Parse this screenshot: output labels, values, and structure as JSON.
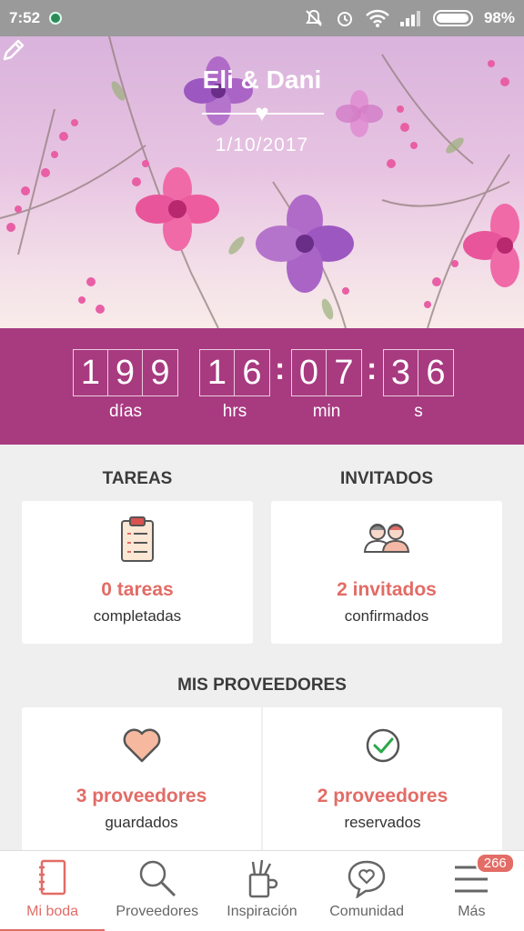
{
  "status_bar": {
    "time": "7:52",
    "battery": "98%"
  },
  "header": {
    "couple": "Eli & Dani",
    "date": "1/10/2017"
  },
  "countdown": {
    "days": [
      "1",
      "9",
      "9"
    ],
    "hours": [
      "1",
      "6"
    ],
    "minutes": [
      "0",
      "7"
    ],
    "seconds": [
      "3",
      "6"
    ],
    "labels": {
      "days": "días",
      "hours": "hrs",
      "minutes": "min",
      "seconds": "s"
    }
  },
  "tasks": {
    "title": "TAREAS",
    "count": "0 tareas",
    "caption": "completadas"
  },
  "guests": {
    "title": "INVITADOS",
    "count": "2 invitados",
    "caption": "confirmados"
  },
  "vendors": {
    "title": "MIS PROVEEDORES",
    "saved_count": "3 proveedores",
    "saved_caption": "guardados",
    "booked_count": "2 proveedores",
    "booked_caption": "reservados"
  },
  "nav": {
    "items": [
      {
        "label": "Mi boda",
        "icon": "notebook-icon"
      },
      {
        "label": "Proveedores",
        "icon": "search-icon"
      },
      {
        "label": "Inspiración",
        "icon": "pencil-cup-icon"
      },
      {
        "label": "Comunidad",
        "icon": "chat-heart-icon"
      },
      {
        "label": "Más",
        "icon": "menu-icon"
      }
    ],
    "badge": "266"
  },
  "colors": {
    "accent": "#e26c66",
    "countdown_bg": "#a83a80",
    "status_bar": "#9a9a9a"
  }
}
